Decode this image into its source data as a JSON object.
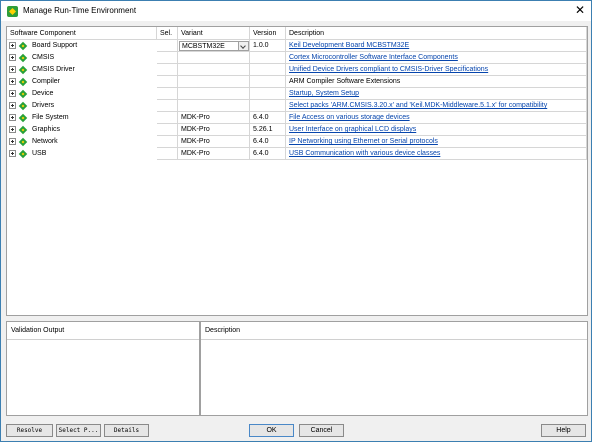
{
  "window": {
    "title": "Manage Run-Time Environment"
  },
  "table": {
    "columns": [
      "Software Component",
      "Sel.",
      "Variant",
      "Version",
      "Description"
    ],
    "rows": [
      {
        "component": "Board Support",
        "sel": "",
        "variant": "MCBSTM32E",
        "variant_dropdown": true,
        "version": "1.0.0",
        "description": "Keil Development Board MCBSTM32E",
        "desc_link": true
      },
      {
        "component": "CMSIS",
        "sel": "",
        "variant": "",
        "variant_dropdown": false,
        "version": "",
        "description": "Cortex Microcontroller Software Interface Components",
        "desc_link": true
      },
      {
        "component": "CMSIS Driver",
        "sel": "",
        "variant": "",
        "variant_dropdown": false,
        "version": "",
        "description": "Unified Device Drivers compliant to CMSIS-Driver Specifications",
        "desc_link": true
      },
      {
        "component": "Compiler",
        "sel": "",
        "variant": "",
        "variant_dropdown": false,
        "version": "",
        "description": "ARM Compiler Software Extensions",
        "desc_link": false
      },
      {
        "component": "Device",
        "sel": "",
        "variant": "",
        "variant_dropdown": false,
        "version": "",
        "description": "Startup, System Setup",
        "desc_link": true
      },
      {
        "component": "Drivers",
        "sel": "",
        "variant": "",
        "variant_dropdown": false,
        "version": "",
        "description": "Select packs 'ARM.CMSIS.3.20.x' and 'Keil.MDK-Middleware.5.1.x' for compatibility",
        "desc_link": true
      },
      {
        "component": "File System",
        "sel": "",
        "variant": "MDK-Pro",
        "variant_dropdown": false,
        "version": "6.4.0",
        "description": "File Access on various storage devices",
        "desc_link": true
      },
      {
        "component": "Graphics",
        "sel": "",
        "variant": "MDK-Pro",
        "variant_dropdown": false,
        "version": "5.26.1",
        "description": "User Interface on graphical LCD displays",
        "desc_link": true
      },
      {
        "component": "Network",
        "sel": "",
        "variant": "MDK-Pro",
        "variant_dropdown": false,
        "version": "6.4.0",
        "description": "IP Networking using Ethernet or Serial protocols",
        "desc_link": true
      },
      {
        "component": "USB",
        "sel": "",
        "variant": "MDK-Pro",
        "variant_dropdown": false,
        "version": "6.4.0",
        "description": "USB Communication with various device classes",
        "desc_link": true
      }
    ]
  },
  "panels": {
    "validation_title": "Validation Output",
    "description_title": "Description"
  },
  "buttons": {
    "resolve": "Resolve",
    "select_packs": "Select P...",
    "details": "Details",
    "ok": "OK",
    "cancel": "Cancel",
    "help": "Help"
  },
  "icons": {
    "expand": "plus-box-icon",
    "component": "green-gem-icon",
    "close": "close-icon"
  },
  "colors": {
    "link": "#0645ad",
    "gem": "#27a13a",
    "grid": "#d6d6d6"
  }
}
